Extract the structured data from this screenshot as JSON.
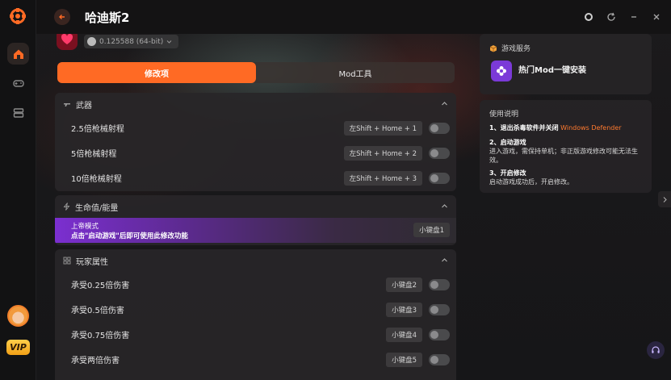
{
  "app": {
    "title": "哈迪斯2"
  },
  "game": {
    "version": "0.125588 (64-bit)"
  },
  "tabs": [
    {
      "label": "修改项",
      "active": true
    },
    {
      "label": "Mod工具",
      "active": false
    }
  ],
  "sections": {
    "weapons": {
      "title": "武器",
      "rows": [
        {
          "label": "2.5倍枪械射程",
          "hotkey": "左Shift + Home + 1"
        },
        {
          "label": "5倍枪械射程",
          "hotkey": "左Shift + Home + 2"
        },
        {
          "label": "10倍枪械射程",
          "hotkey": "左Shift + Home + 3"
        }
      ]
    },
    "health": {
      "title": "生命值/能量",
      "god_mode_title": "上帝模式",
      "god_mode_desc": "点击\"启动游戏\"后即可使用此修改功能",
      "god_mode_hotkey": "小键盘1"
    },
    "player": {
      "title": "玩家属性",
      "rows": [
        {
          "label": "承受0.25倍伤害",
          "hotkey": "小键盘2"
        },
        {
          "label": "承受0.5倍伤害",
          "hotkey": "小键盘3"
        },
        {
          "label": "承受0.75倍伤害",
          "hotkey": "小键盘4"
        },
        {
          "label": "承受两倍伤害",
          "hotkey": "小键盘5"
        }
      ]
    }
  },
  "side": {
    "service_title": "游戏服务",
    "service_item": "热门Mod一键安装",
    "guide_title": "使用说明",
    "steps": [
      {
        "title": "1、退出杀毒软件并关闭",
        "highlight": "Windows Defender",
        "body": ""
      },
      {
        "title": "2、启动游戏",
        "highlight": "",
        "body": "进入游戏，需保持单机；非正版游戏修改可能无法生效。"
      },
      {
        "title": "3、开启修改",
        "highlight": "",
        "body": "启动游戏成功后，开启修改。"
      }
    ]
  },
  "rail": {
    "vip_label": "VIP"
  },
  "colors": {
    "accent": "#ff6a24",
    "god_mode": "#7b2fd0"
  }
}
